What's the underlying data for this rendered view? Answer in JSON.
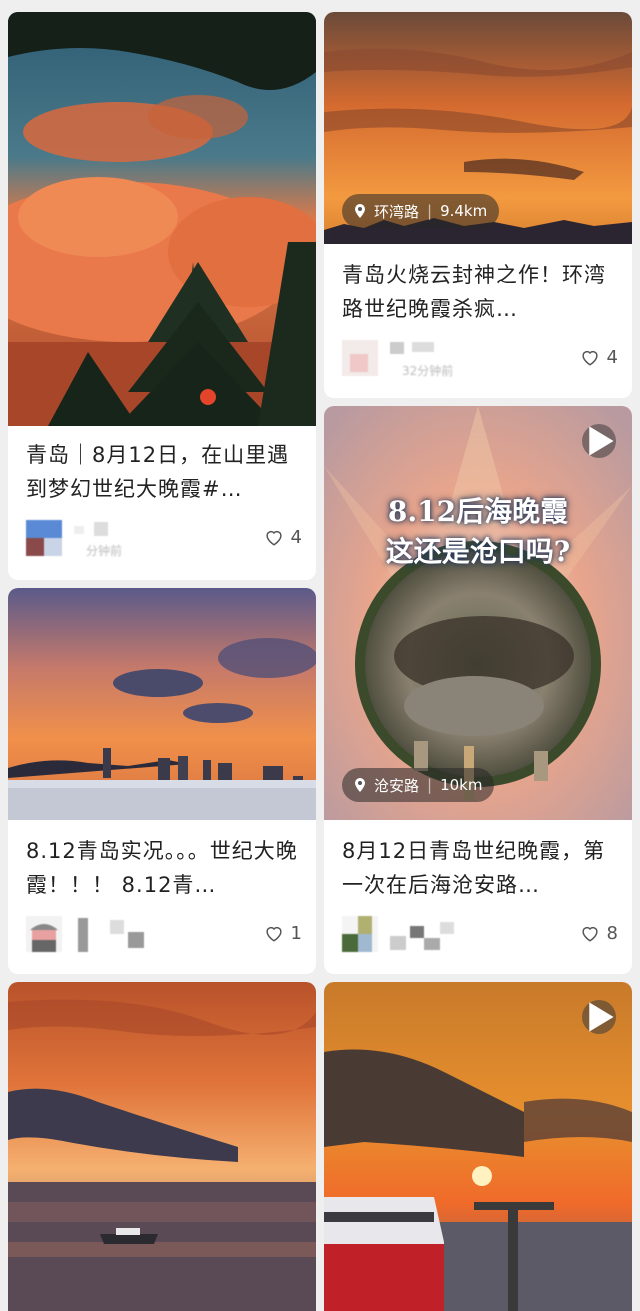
{
  "feed": {
    "cards": [
      {
        "title": "青岛｜8月12日，在山里遇到梦幻世纪大晚霞#…",
        "likes": "4",
        "time_blurred": "分钟前"
      },
      {
        "title": "青岛火烧云封神之作！环湾路世纪晚霞杀疯…",
        "location": "环湾路",
        "distance": "9.4km",
        "likes": "4",
        "time_blurred": "32分钟前"
      },
      {
        "title": "8.12青岛实况。。。世纪大晚霞！！！ 8.12青…",
        "likes": "1"
      },
      {
        "title": "8月12日青岛世纪晚霞，第一次在后海沧安路…",
        "overlay_line1": "8.12后海晚霞",
        "overlay_line2": "这还是沧口吗?",
        "location": "沧安路",
        "distance": "10km",
        "likes": "8",
        "is_video": true
      },
      {
        "image": "sunset-sea-boat"
      },
      {
        "image": "sunset-pier",
        "is_video": true
      }
    ]
  },
  "colors": {
    "accent_text": "#222222",
    "meta_gray": "#555555"
  }
}
